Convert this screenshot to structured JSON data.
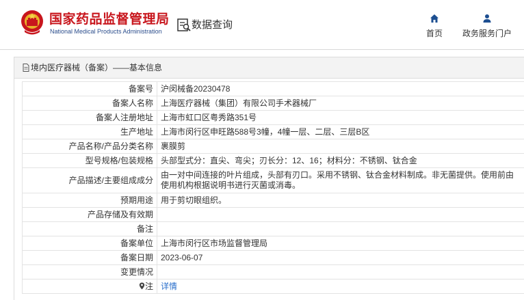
{
  "header": {
    "org_name_cn": "国家药品监督管理局",
    "org_name_en": "National Medical Products Administration",
    "query_label": "数据查询",
    "nav": [
      {
        "label": "首页",
        "icon": "home-icon"
      },
      {
        "label": "政务服务门户",
        "icon": "user-icon"
      }
    ]
  },
  "panel": {
    "title": "境内医疗器械（备案）——基本信息"
  },
  "rows": [
    {
      "label": "备案号",
      "value": "沪闵械备20230478"
    },
    {
      "label": "备案人名称",
      "value": "上海医疗器械（集团）有限公司手术器械厂"
    },
    {
      "label": "备案人注册地址",
      "value": "上海市虹口区粤秀路351号"
    },
    {
      "label": "生产地址",
      "value": "上海市闵行区申旺路588号3幢，4幢一层、二层、三层B区"
    },
    {
      "label": "产品名称/产品分类名称",
      "value": "裹膜剪"
    },
    {
      "label": "型号规格/包装规格",
      "value": "头部型式分：直尖、弯尖；刃长分：12、16；材料分：不锈钢、钛合金"
    },
    {
      "label": "产品描述/主要组成成分",
      "value": "由一对中间连接的叶片组成，头部有刃口。采用不锈钢、钛合金材料制成。非无菌提供。使用前由使用机构根据说明书进行灭菌或消毒。"
    },
    {
      "label": "预期用途",
      "value": "用于剪切眼组织。"
    },
    {
      "label": "产品存储及有效期",
      "value": ""
    },
    {
      "label": "备注",
      "value": ""
    },
    {
      "label": "备案单位",
      "value": "上海市闵行区市场监督管理局"
    },
    {
      "label": "备案日期",
      "value": "2023-06-07"
    },
    {
      "label": "变更情况",
      "value": ""
    },
    {
      "label": "注",
      "value": "详情",
      "icon": "location-pin-icon"
    }
  ],
  "colors": {
    "brand_red": "#c8161d",
    "brand_blue": "#2b4d8c",
    "link_blue": "#2a6fcb",
    "nav_icon": "#1d4f91"
  }
}
